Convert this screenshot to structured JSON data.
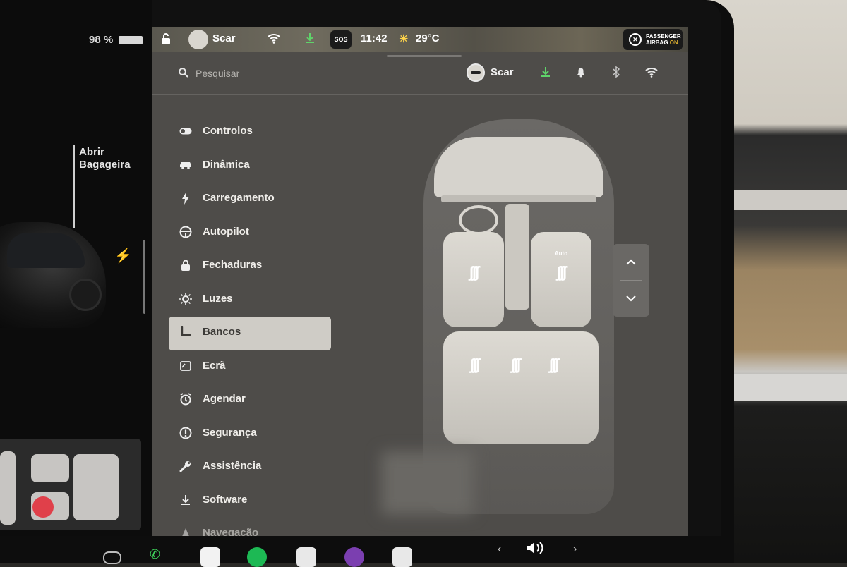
{
  "status": {
    "battery_percent": "98 %",
    "driver_name": "Scar",
    "sos_label": "SOS",
    "time": "11:42",
    "temperature": "29°C",
    "airbag_line1": "PASSENGER",
    "airbag_line2": "AIRBAG",
    "airbag_state": "ON"
  },
  "left_panel": {
    "trunk_line1": "Abrir",
    "trunk_line2": "Bagageira"
  },
  "header": {
    "search_placeholder": "Pesquisar",
    "profile_name": "Scar"
  },
  "menu": {
    "items": [
      {
        "label": "Controlos",
        "icon": "toggle-icon"
      },
      {
        "label": "Dinâmica",
        "icon": "car-icon"
      },
      {
        "label": "Carregamento",
        "icon": "bolt-icon"
      },
      {
        "label": "Autopilot",
        "icon": "steering-wheel-icon"
      },
      {
        "label": "Fechaduras",
        "icon": "lock-icon"
      },
      {
        "label": "Luzes",
        "icon": "sun-icon"
      },
      {
        "label": "Bancos",
        "icon": "seat-icon",
        "active": true
      },
      {
        "label": "Ecrã",
        "icon": "display-icon"
      },
      {
        "label": "Agendar",
        "icon": "alarm-clock-icon"
      },
      {
        "label": "Segurança",
        "icon": "alert-circle-icon"
      },
      {
        "label": "Assistência",
        "icon": "wrench-icon"
      },
      {
        "label": "Software",
        "icon": "download-icon"
      },
      {
        "label": "Navegação",
        "icon": "navigation-arrow-icon"
      }
    ]
  },
  "seats": {
    "passenger_mode": "Auto"
  },
  "colors": {
    "panel_bg": "#4e4c49",
    "active_item_bg": "#cfccc6",
    "download_green": "#5fd36a",
    "airbag_on": "#e3b432",
    "alert_red": "#e0404a"
  }
}
